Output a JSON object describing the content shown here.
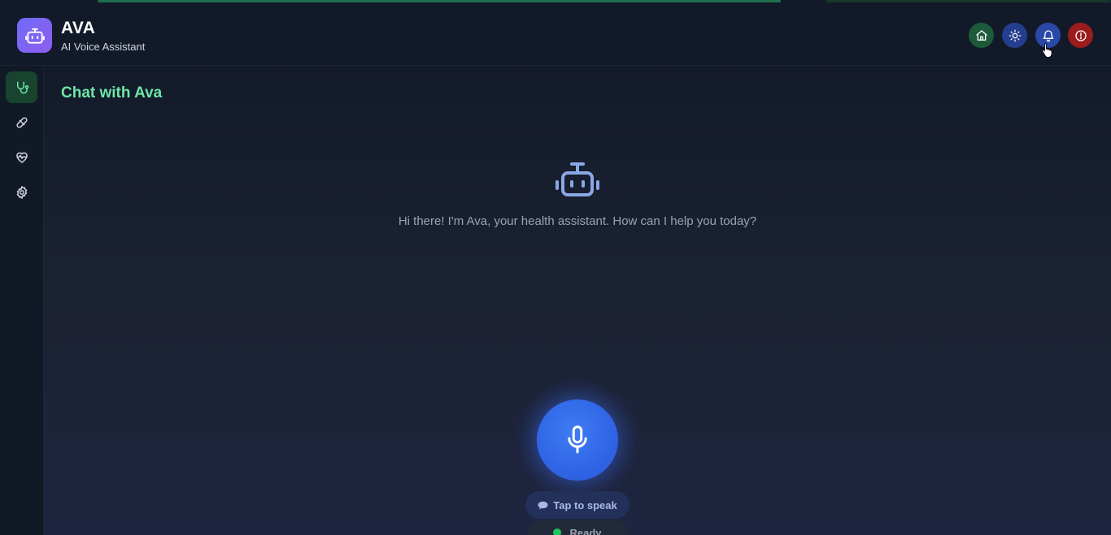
{
  "app": {
    "name": "AVA",
    "subtitle": "AI Voice Assistant"
  },
  "header": {
    "buttons": [
      {
        "name": "home",
        "icon": "home-icon",
        "color": "#1d5a3a"
      },
      {
        "name": "theme",
        "icon": "sun-icon",
        "color": "#243e8d"
      },
      {
        "name": "notifications",
        "icon": "bell-icon",
        "color": "#2948a8"
      },
      {
        "name": "power",
        "icon": "power-alert-icon",
        "color": "#9b1c1c"
      }
    ]
  },
  "sidebar": {
    "items": [
      {
        "name": "chat",
        "icon": "stethoscope-icon",
        "active": true
      },
      {
        "name": "medications",
        "icon": "pill-icon",
        "active": false
      },
      {
        "name": "health",
        "icon": "heart-pulse-icon",
        "active": false
      },
      {
        "name": "settings",
        "icon": "gear-icon",
        "active": false
      }
    ]
  },
  "main": {
    "title": "Chat with Ava",
    "greeting": "Hi there! I'm Ava, your health assistant. How can I help you today?",
    "mic_icon": "microphone-icon",
    "tap_label": "Tap to speak",
    "status_label": "Ready"
  },
  "colors": {
    "accent_green": "#6ee7a7",
    "mic_blue": "#2f65e6",
    "status_green": "#22c55e"
  }
}
